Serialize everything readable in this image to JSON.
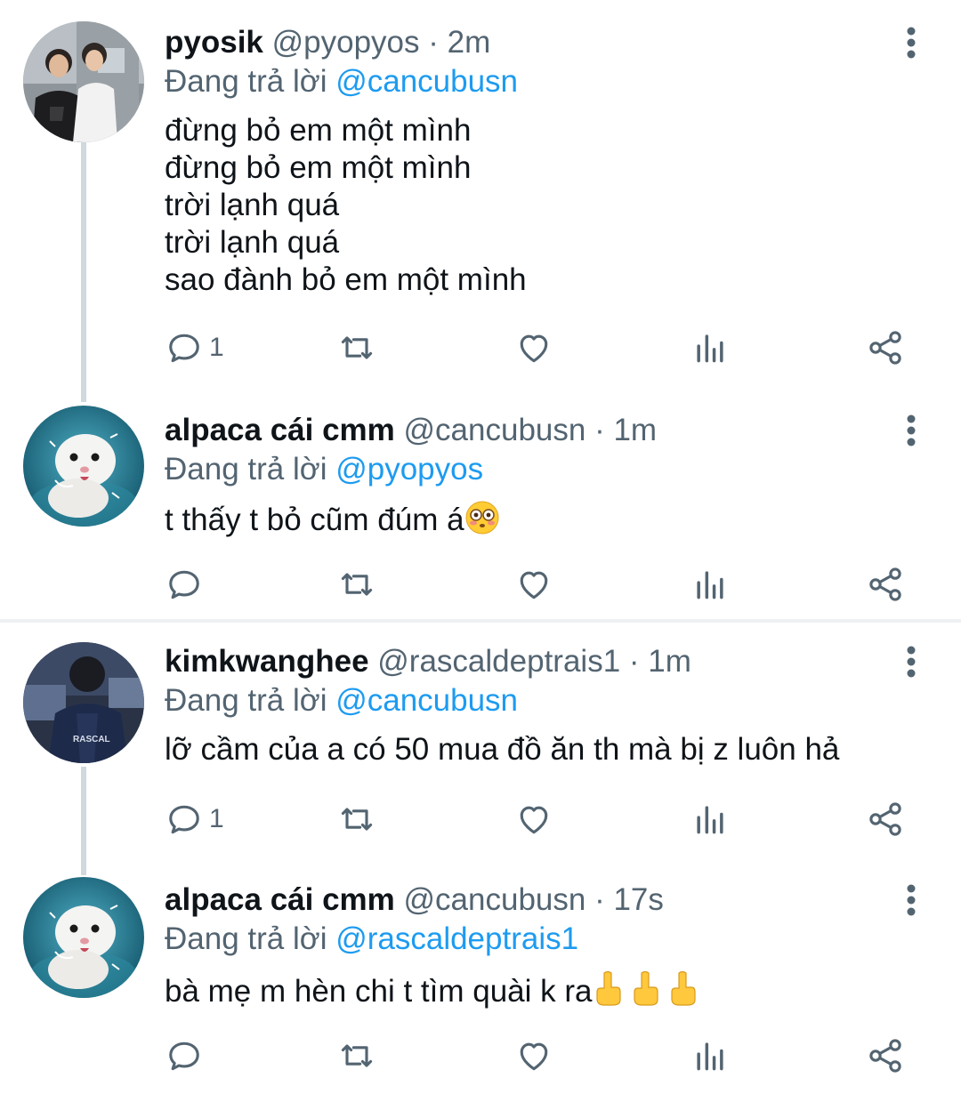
{
  "tweets": [
    {
      "name": "pyosik",
      "handle": "@pyopyos",
      "time": "· 2m",
      "reply_prefix": "Đang trả lời",
      "reply_to": "@cancubusn",
      "text": "đừng bỏ em một mình\nđừng bỏ em một mình\ntrời lạnh quá\ntrời lạnh quá\nsao đành bỏ em một mình",
      "reply_count": "1"
    },
    {
      "name": "alpaca cái cmm",
      "handle": "@cancubusn",
      "time": "· 1m",
      "reply_prefix": "Đang trả lời",
      "reply_to": "@pyopyos",
      "text": "t thấy t bỏ cũm đúm á",
      "reply_count": ""
    },
    {
      "name": "kimkwanghee",
      "handle": "@rascaldeptrais1",
      "time": "· 1m",
      "reply_prefix": "Đang trả lời",
      "reply_to": "@cancubusn",
      "text": "lỡ cầm của a có 50 mua đồ ăn th mà bị z luôn hả",
      "reply_count": "1"
    },
    {
      "name": "alpaca cái cmm",
      "handle": "@cancubusn",
      "time": "· 17s",
      "reply_prefix": "Đang trả lời",
      "reply_to": "@rascaldeptrais1",
      "text": "bà mẹ m hèn chi t tìm quài k ra",
      "reply_count": ""
    }
  ],
  "avatar_text": {
    "jersey": "RASCAL"
  },
  "icons": [
    "reply-icon",
    "retweet-icon",
    "like-icon",
    "analytics-icon",
    "share-icon",
    "more-icon"
  ],
  "colors": {
    "accent": "#1d9bf0",
    "muted": "#536471",
    "icon": "#536471",
    "thread_line": "#cfd9de"
  }
}
